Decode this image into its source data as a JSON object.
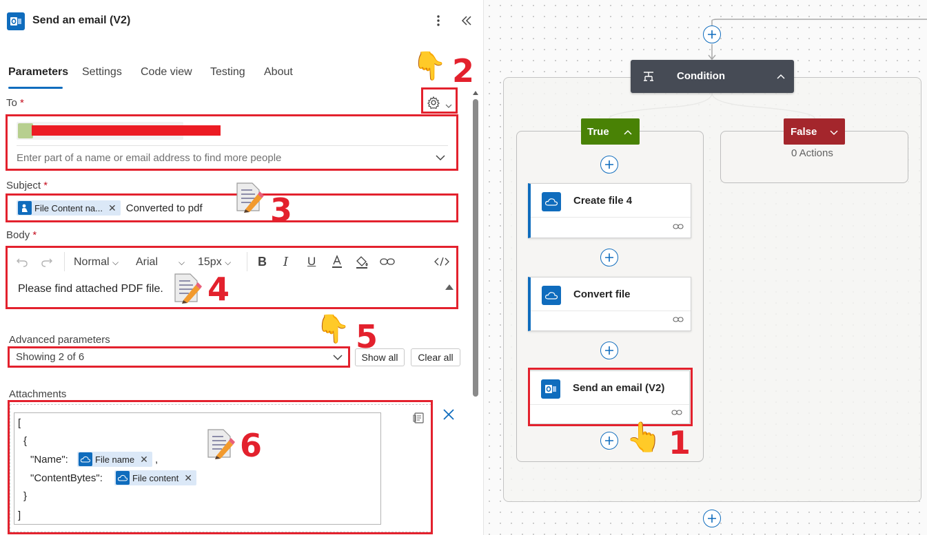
{
  "panel": {
    "title": "Send an email (V2)",
    "tabs": [
      "Parameters",
      "Settings",
      "Code view",
      "Testing",
      "About"
    ]
  },
  "to": {
    "label": "To",
    "required_mark": "*",
    "placeholder": "Enter part of a name or email address to find more people"
  },
  "subject": {
    "label": "Subject",
    "required_mark": "*",
    "token": "File Content na...",
    "text": "Converted to pdf"
  },
  "body": {
    "label": "Body",
    "required_mark": "*",
    "format": "Normal",
    "font": "Arial",
    "size": "15px",
    "text": "Please find attached PDF file."
  },
  "advanced": {
    "label": "Advanced parameters",
    "value": "Showing 2 of 6",
    "show_all": "Show all",
    "clear_all": "Clear all"
  },
  "attachments": {
    "label": "Attachments",
    "open_bracket": "[",
    "open_brace": "{",
    "name_key": "\"Name\":",
    "name_token": "File name",
    "comma": ",",
    "content_key": "\"ContentBytes\":",
    "content_token": "File content",
    "close_brace": "}",
    "close_bracket": "]"
  },
  "annotations": [
    "1",
    "2",
    "3",
    "4",
    "5",
    "6"
  ],
  "flow": {
    "condition": "Condition",
    "true_label": "True",
    "false_label": "False",
    "false_actions": "0 Actions",
    "nodes": [
      "Create file 4",
      "Convert file",
      "Send an email (V2)"
    ]
  },
  "colors": {
    "accent": "#0f6cbd",
    "annotation_red": "#e3212d",
    "true_green": "#498205",
    "false_red": "#a4262c",
    "condition_dark": "#464b55"
  }
}
